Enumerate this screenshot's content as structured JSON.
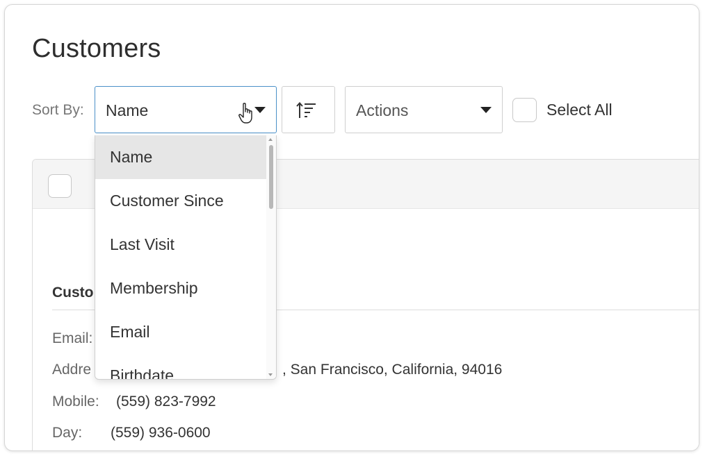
{
  "page": {
    "title": "Customers"
  },
  "toolbar": {
    "sort_label": "Sort By:",
    "sort_value": "Name",
    "actions_value": "Actions",
    "select_all_label": "Select All"
  },
  "sort_options": [
    {
      "label": "Name",
      "selected": true
    },
    {
      "label": "Customer Since"
    },
    {
      "label": "Last Visit"
    },
    {
      "label": "Membership"
    },
    {
      "label": "Email"
    },
    {
      "label": "Birthdate"
    }
  ],
  "customer": {
    "section_title": "Custo",
    "email_label": "Email:",
    "address_label": "Addre",
    "address_value": ", San Francisco, California, 94016",
    "mobile_label": "Mobile:",
    "mobile_value": "(559) 823-7992",
    "day_label": "Day:",
    "day_value": "(559) 936-0600"
  },
  "colors": {
    "focus_border": "#4a90c8",
    "selected_option_bg": "#e6e6e6"
  },
  "icons": {
    "sort_order": "sort-ascending-icon",
    "cursor": "hand-pointer-icon",
    "caret": "caret-down-icon"
  }
}
